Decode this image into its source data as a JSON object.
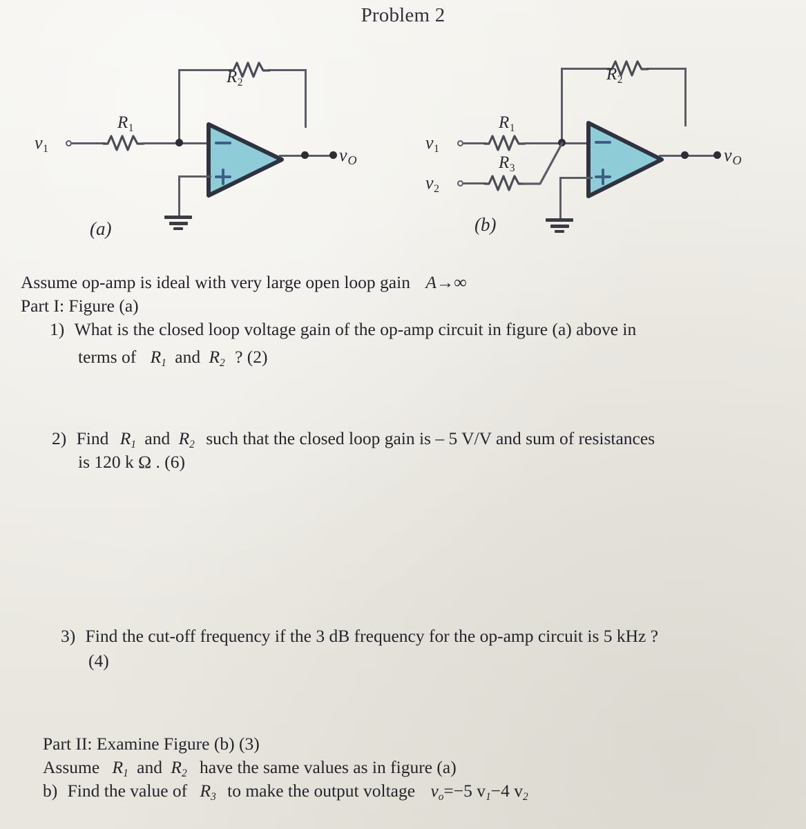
{
  "page": {
    "title": "Problem 2",
    "background_color": "#eeece6",
    "ink_color": "#24242c"
  },
  "figures": {
    "a": {
      "caption": "(a)",
      "opamp_fill": "#8ecdd8",
      "opamp_stroke": "#2f3340",
      "inverting_sign": "−",
      "noninverting_sign": "+",
      "labels": {
        "r1": "R",
        "r1_sub": "1",
        "r2": "R",
        "r2_sub": "2",
        "vin": "v",
        "vin_sub": "1",
        "vout": "v",
        "vout_sub": "O"
      }
    },
    "b": {
      "caption": "(b)",
      "opamp_fill": "#8ecdd8",
      "opamp_stroke": "#2f3340",
      "inverting_sign": "−",
      "noninverting_sign": "+",
      "labels": {
        "r1": "R",
        "r1_sub": "1",
        "r2": "R",
        "r2_sub": "2",
        "r3": "R",
        "r3_sub": "3",
        "vin1": "v",
        "vin1_sub": "1",
        "vin2": "v",
        "vin2_sub": "2",
        "vout": "v",
        "vout_sub": "O"
      }
    }
  },
  "body": {
    "assume_line": "Assume op-amp is ideal with very large open loop gain",
    "assume_gain": "A→∞",
    "part1_heading": "Part I:  Figure (a)",
    "q1": {
      "number": "1)",
      "line1": "What is the closed loop voltage gain of the op-amp circuit in figure (a) above in",
      "line2_pre": "terms of",
      "line2_r1": "R",
      "line2_r1_sub": "1",
      "line2_and": "and",
      "line2_r2": "R",
      "line2_r2_sub": "2",
      "line2_post": "? (2)"
    },
    "q2": {
      "number": "2)",
      "line1_pre": "Find",
      "line1_r1": "R",
      "line1_r1_sub": "1",
      "line1_and": "and",
      "line1_r2": "R",
      "line1_r2_sub": "2",
      "line1_post": "such that the closed loop gain is – 5 V/V and sum of resistances",
      "line2": "is 120 k  Ω .  (6)"
    },
    "q3": {
      "number": "3)",
      "line1": "Find the cut-off frequency if the 3 dB frequency for the op-amp circuit is 5 kHz ?",
      "line2": "(4)"
    },
    "part2_heading": "Part II:  Examine Figure (b)    (3)",
    "part2_assume_pre": "Assume",
    "part2_assume_r1": "R",
    "part2_assume_r1_sub": "1",
    "part2_assume_and": "and",
    "part2_assume_r2": "R",
    "part2_assume_r2_sub": "2",
    "part2_assume_post": "have the same values as in figure (a)",
    "qb": {
      "number": "b)",
      "pre": "Find the value of",
      "r3": "R",
      "r3_sub": "3",
      "mid": "to make the output voltage",
      "eq_v": "v",
      "eq_v_sub": "o",
      "eq_rest": "=−5 v",
      "eq_sub1": "1",
      "eq_rest2": "−4 v",
      "eq_sub2": "2"
    }
  }
}
